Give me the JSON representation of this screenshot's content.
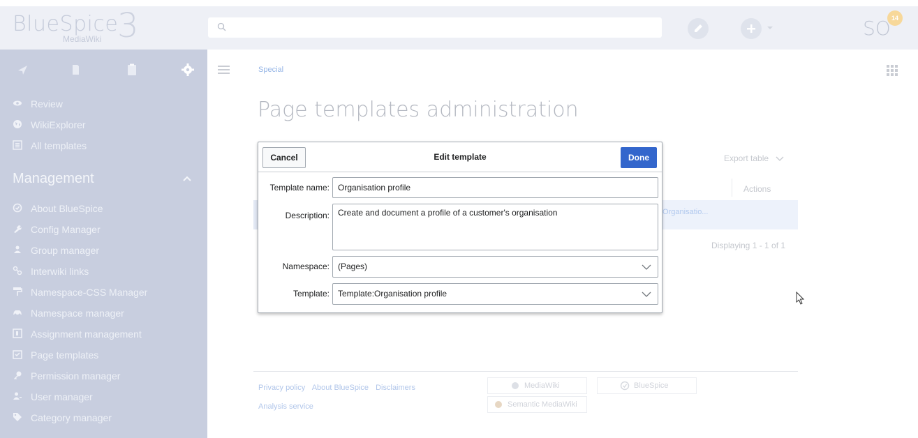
{
  "header": {
    "logo_text": "BlueSpice",
    "logo_sub": "MediaWiki",
    "logo_version": "3",
    "user_initials": "SO",
    "notification_count": "14"
  },
  "sidebar": {
    "tab_icons": [
      "compass-icon",
      "book-icon",
      "clipboard-icon",
      "gear-icon"
    ],
    "items": [
      {
        "icon": "eye-icon",
        "label": "Review"
      },
      {
        "icon": "globe-icon",
        "label": "WikiExplorer"
      },
      {
        "icon": "list-icon",
        "label": "All templates"
      }
    ],
    "management_heading": "Management",
    "management_items": [
      {
        "icon": "clock-icon",
        "label": "About BlueSpice"
      },
      {
        "icon": "wrench-icon",
        "label": "Config Manager"
      },
      {
        "icon": "group-icon",
        "label": "Group manager"
      },
      {
        "icon": "link-icon",
        "label": "Interwiki links"
      },
      {
        "icon": "paint-roller-icon",
        "label": "Namespace-CSS Manager"
      },
      {
        "icon": "car-icon",
        "label": "Namespace manager"
      },
      {
        "icon": "assignment-icon",
        "label": "Assignment management"
      },
      {
        "icon": "page-template-icon",
        "label": "Page templates"
      },
      {
        "icon": "key-icon",
        "label": "Permission manager"
      },
      {
        "icon": "user-icon",
        "label": "User manager"
      },
      {
        "icon": "tag-icon",
        "label": "Category manager"
      }
    ]
  },
  "main": {
    "breadcrumb": "Special",
    "title": "Page templates administration",
    "export_label": "Export table",
    "actions_header": "Actions",
    "row_link": ":Organisatio...",
    "displaying": "Displaying 1 - 1 of 1"
  },
  "dialog": {
    "cancel_label": "Cancel",
    "title": "Edit template",
    "done_label": "Done",
    "fields": {
      "name_label": "Template name:",
      "name_value": "Organisation profile",
      "description_label": "Description:",
      "description_value": "Create and document a profile of a customer's organisation",
      "namespace_label": "Namespace:",
      "namespace_value": "(Pages)",
      "template_label": "Template:",
      "template_value": "Template:Organisation profile"
    }
  },
  "footer": {
    "links": [
      "Privacy policy",
      "About BlueSpice",
      "Disclaimers"
    ],
    "links2": [
      "Analysis service"
    ],
    "badges": [
      "MediaWiki",
      "BlueSpice",
      "Semantic MediaWiki"
    ]
  },
  "colors": {
    "accent": "#3366cc",
    "sidebar_bg": "#c8cedf",
    "header_bg": "#eef0f6"
  }
}
